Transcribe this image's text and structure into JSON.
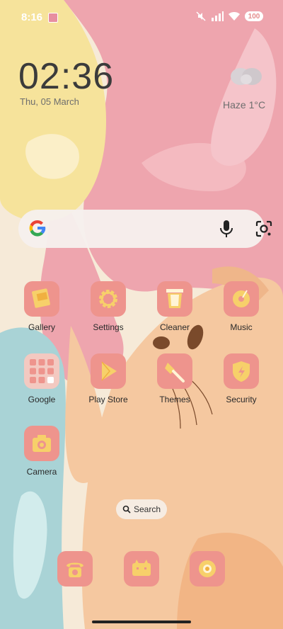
{
  "status_bar": {
    "time": "8:16",
    "battery": "100"
  },
  "clock_widget": {
    "time": "02:36",
    "date": "Thu, 05 March"
  },
  "weather_widget": {
    "text": "Haze  1°C",
    "icon": "cloud-icon"
  },
  "google_search": {
    "logo": "google-g-icon",
    "mic": "mic-icon",
    "lens": "lens-icon"
  },
  "apps": [
    {
      "label": "Gallery",
      "icon": "gallery-icon"
    },
    {
      "label": "Settings",
      "icon": "gear-icon"
    },
    {
      "label": "Cleaner",
      "icon": "cleaner-icon"
    },
    {
      "label": "Music",
      "icon": "music-icon"
    },
    {
      "label": "Google",
      "icon": "google-folder-icon"
    },
    {
      "label": "Play Store",
      "icon": "play-store-icon"
    },
    {
      "label": "Themes",
      "icon": "brush-icon"
    },
    {
      "label": "Security",
      "icon": "shield-icon"
    },
    {
      "label": "Camera",
      "icon": "camera-icon"
    }
  ],
  "app_search": {
    "label": "Search"
  },
  "dock": [
    {
      "icon": "phone-icon"
    },
    {
      "icon": "messages-icon"
    },
    {
      "icon": "browser-icon"
    }
  ],
  "colors": {
    "tile": "#ee948d",
    "icon_yellow": "#f7d06a",
    "wall_pink": "#eea5ae",
    "wall_yellow": "#f6e39b",
    "wall_teal": "#a9d3d6"
  }
}
